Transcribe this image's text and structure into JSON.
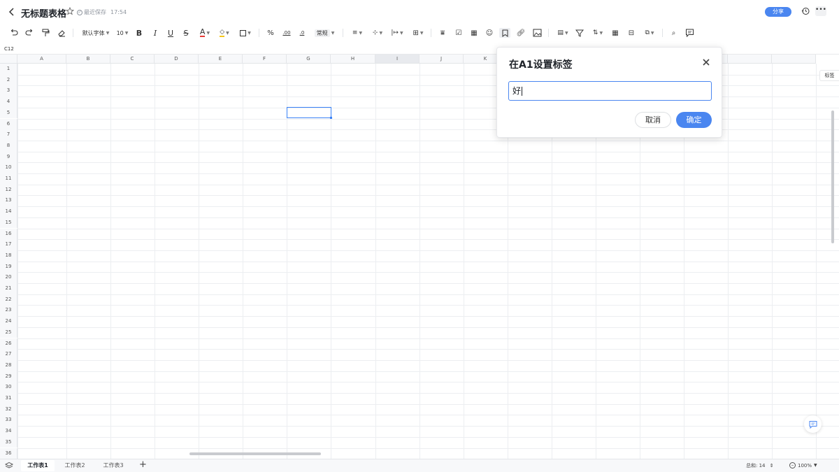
{
  "header": {
    "back_icon": "chevron-left-icon",
    "title": "无标题表格",
    "save_status": "最近保存",
    "save_time": "17:54",
    "share_label": "分享"
  },
  "toolbar": {
    "font_name": "默认字体",
    "font_size": "10",
    "number_format": "常规",
    "percent": "%",
    "decimal_decrease": ".00",
    "decimal_increase": ".0"
  },
  "namebox": "C12",
  "grid": {
    "columns": [
      "A",
      "B",
      "C",
      "D",
      "E",
      "F",
      "G",
      "H",
      "I",
      "J",
      "K"
    ],
    "selected_column": "I",
    "rows": [
      "1",
      "2",
      "3",
      "4",
      "5",
      "6",
      "7",
      "8",
      "9",
      "10",
      "11",
      "12",
      "13",
      "14",
      "15",
      "16",
      "17",
      "18",
      "19",
      "20",
      "21",
      "22",
      "23",
      "24",
      "25",
      "26",
      "27",
      "28",
      "29",
      "30",
      "31",
      "32",
      "33",
      "34",
      "35",
      "36"
    ]
  },
  "dialog": {
    "title": "在A1设置标签",
    "input_value": "好",
    "cancel_label": "取消",
    "ok_label": "确定"
  },
  "side_panel": {
    "tag_label": "标签"
  },
  "sheets": [
    {
      "label": "工作表1",
      "active": true
    },
    {
      "label": "工作表2",
      "active": false
    },
    {
      "label": "工作表3",
      "active": false
    }
  ],
  "status": {
    "sum_label": "总和:",
    "sum_value": "14",
    "zoom": "100%"
  },
  "colors": {
    "accent": "#4a86f0",
    "selection": "#3b82f6"
  }
}
